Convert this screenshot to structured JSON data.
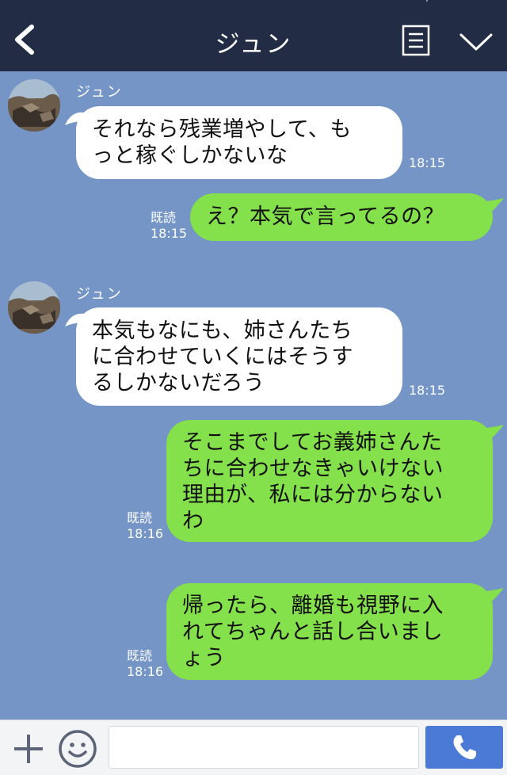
{
  "header": {
    "title": "ジュン"
  },
  "messages": [
    {
      "sender": "ジュン",
      "lines": [
        "それなら残業増やして、も",
        "っと稼ぐしかないな"
      ],
      "time": "18:15"
    },
    {
      "read": "既読",
      "time": "18:15",
      "lines": [
        "え？本気で言ってるの？"
      ]
    },
    {
      "sender": "ジュン",
      "lines": [
        "本気もなにも、姉さんたち",
        "に合わせていくにはそうす",
        "るしかないだろう"
      ],
      "time": "18:15"
    },
    {
      "read": "既読",
      "time": "18:16",
      "lines": [
        "そこまでしてお義姉さんた",
        "ちに合わせなきゃいけない",
        "理由が、私には分からない",
        "わ"
      ]
    },
    {
      "read": "既読",
      "time": "18:16",
      "lines": [
        "帰ったら、離婚も視野に入",
        "れてちゃんと話し合いまし",
        "ょう"
      ]
    }
  ],
  "footer": {
    "input_value": "",
    "input_placeholder": ""
  },
  "colors": {
    "header_bg": "#222d45",
    "chat_bg": "#7495c6",
    "incoming_bubble": "#ffffff",
    "outgoing_bubble": "#84e04b",
    "call_button": "#4a7ad6"
  },
  "icons": [
    "back-arrow-icon",
    "notes-icon",
    "chevron-down-icon",
    "plus-icon",
    "smiley-icon",
    "phone-icon"
  ]
}
